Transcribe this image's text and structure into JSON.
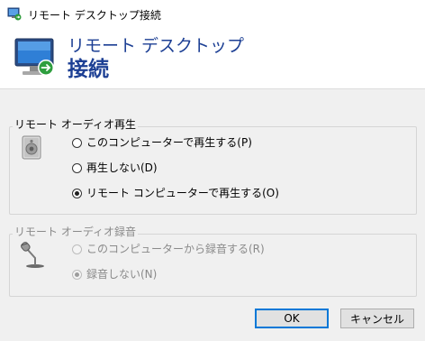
{
  "window": {
    "title": "リモート デスクトップ接続"
  },
  "header": {
    "line1": "リモート デスクトップ",
    "line2": "接続"
  },
  "playback": {
    "group_title": "リモート オーディオ再生",
    "options": [
      {
        "label": "このコンピューターで再生する(P)",
        "checked": false
      },
      {
        "label": "再生しない(D)",
        "checked": false
      },
      {
        "label": "リモート コンピューターで再生する(O)",
        "checked": true
      }
    ]
  },
  "recording": {
    "group_title": "リモート オーディオ録音",
    "options": [
      {
        "label": "このコンピューターから録音する(R)",
        "checked": false,
        "disabled": true
      },
      {
        "label": "録音しない(N)",
        "checked": true,
        "disabled": true
      }
    ]
  },
  "buttons": {
    "ok": "OK",
    "cancel": "キャンセル"
  },
  "colors": {
    "accent": "#0078d7",
    "header_text": "#1c3f94"
  },
  "icons": {
    "app": "remote-desktop-icon",
    "header": "remote-desktop-monitor-icon",
    "playback": "speaker-icon",
    "recording": "microphone-icon"
  }
}
